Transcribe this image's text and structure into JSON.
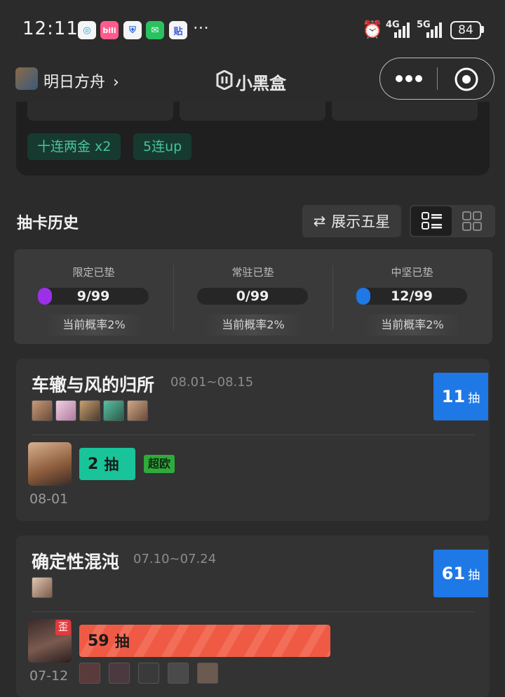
{
  "status_bar": {
    "time": "12:11",
    "app_icons": [
      "china-mobile-icon",
      "bilibili-icon",
      "shield-icon",
      "wechat-icon",
      "tieba-icon"
    ],
    "more": "···",
    "network_4g": "4G",
    "network_5g": "5G",
    "battery": "84"
  },
  "header": {
    "game_name": "明日方舟",
    "brand_name": "小黑盒"
  },
  "top_card": {
    "tags": [
      "十连两金  x2",
      "5连up"
    ]
  },
  "history": {
    "title": "抽卡历史",
    "toggle_label": "展示五星"
  },
  "pity": [
    {
      "label": "限定已垫",
      "value": "9/99",
      "progress": 0.09,
      "color": "#9b30e8",
      "rate": "当前概率2%"
    },
    {
      "label": "常驻已垫",
      "value": "0/99",
      "progress": 0.0,
      "color": "#888888",
      "rate": "当前概率2%"
    },
    {
      "label": "中坚已垫",
      "value": "12/99",
      "progress": 0.12,
      "color": "#1e78e6",
      "rate": "当前概率2%"
    }
  ],
  "banners": [
    {
      "name": "车辙与风的归所",
      "dates": "08.01~08.15",
      "pulls": "11",
      "pull_unit": "抽",
      "five_star": {
        "pulls": "2",
        "unit": "抽",
        "tag": "超欧",
        "date": "08-01"
      }
    },
    {
      "name": "确定性混沌",
      "dates": "07.10~07.24",
      "pulls": "61",
      "pull_unit": "抽",
      "five_star": {
        "pulls": "59",
        "unit": "抽",
        "wai": "歪",
        "date": "07-12"
      }
    }
  ],
  "colors": {
    "accent_blue": "#1e78e6",
    "green_bar": "#19c49a",
    "red_bar": "#ef5a45"
  }
}
